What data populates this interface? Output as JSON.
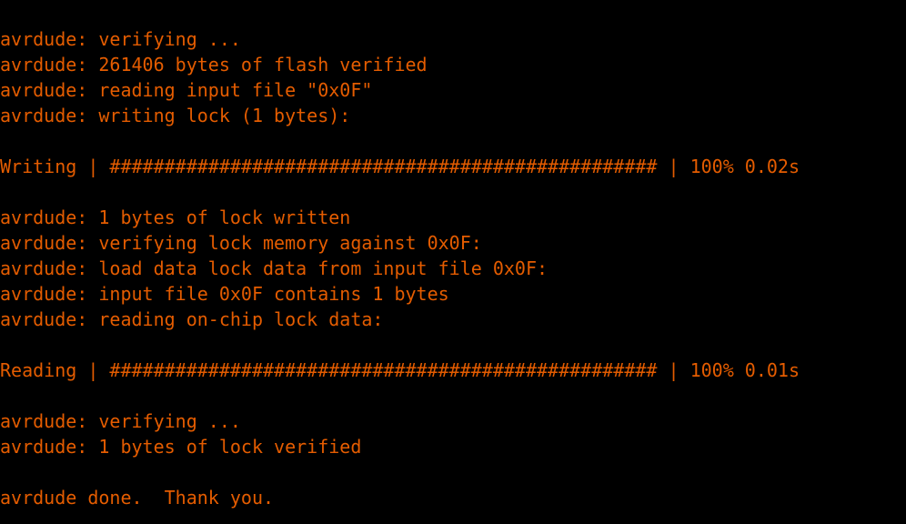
{
  "terminal": {
    "text_color": "#e45c00",
    "background": "#000000",
    "lines": [
      "avrdude: verifying ...",
      "avrdude: 261406 bytes of flash verified",
      "avrdude: reading input file \"0x0F\"",
      "avrdude: writing lock (1 bytes):",
      "",
      "Writing | ################################################## | 100% 0.02s",
      "",
      "avrdude: 1 bytes of lock written",
      "avrdude: verifying lock memory against 0x0F:",
      "avrdude: load data lock data from input file 0x0F:",
      "avrdude: input file 0x0F contains 1 bytes",
      "avrdude: reading on-chip lock data:",
      "",
      "Reading | ################################################## | 100% 0.01s",
      "",
      "avrdude: verifying ...",
      "avrdude: 1 bytes of lock verified",
      "",
      "avrdude done.  Thank you."
    ]
  }
}
